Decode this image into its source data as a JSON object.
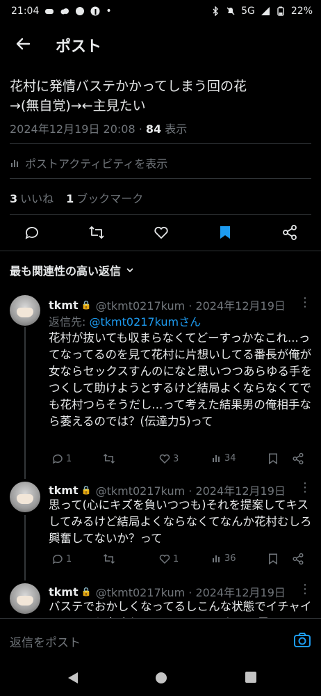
{
  "status_bar": {
    "time": "21:04",
    "network": "5G",
    "battery": "22%"
  },
  "header": {
    "title": "ポスト"
  },
  "post": {
    "text": "花村に発情バステかかってしまう回の花\n→(無自覚)→←主見たい",
    "timestamp": "2024年12月19日 20:08 · ",
    "views_count": "84",
    "views_label": " 表示",
    "activity_label": "ポストアクティビティを表示",
    "likes_count": "3",
    "likes_label": "いいね",
    "bookmarks_count": "1",
    "bookmarks_label": "ブックマーク"
  },
  "sort_label": "最も関連性の高い返信",
  "replies": [
    {
      "name": "tkmt",
      "handle_time": "@tkmt0217kum · 2024年12月19日",
      "replying_prefix": "返信先: ",
      "replying_to": "@tkmt0217kumさん",
      "text": "花村が抜いても収まらなくてどーすっかなこれ...ってなってるのを見て花村に片想いしてる番長が俺が女ならセックスすんのになと思いつつあらゆる手をつくして助けようとするけど結局よくならなくてでも花村つらそうだし...って考えた結果男の俺相手なら萎えるのでは？(伝達力5)って",
      "replies": "1",
      "likes": "3",
      "views": "34"
    },
    {
      "name": "tkmt",
      "handle_time": "@tkmt0217kum · 2024年12月19日",
      "text": "思って(心にキズを負いつつも)それを提案してキスしてみるけど結局よくならなくてなんか花村むしろ興奮してないか？って",
      "replies": "1",
      "likes": "1",
      "views": "36"
    },
    {
      "name": "tkmt",
      "handle_time": "@tkmt0217kum · 2024年12月19日",
      "text": "バステでおかしくなってるしこんな状態でイチャイチャしても意味ないし フェアじゃないと思"
    }
  ],
  "compose": {
    "placeholder": "返信をポスト"
  },
  "colors": {
    "accent": "#1d9bf0",
    "muted": "#71767b",
    "text": "#e7e9ea",
    "background": "#000000"
  }
}
